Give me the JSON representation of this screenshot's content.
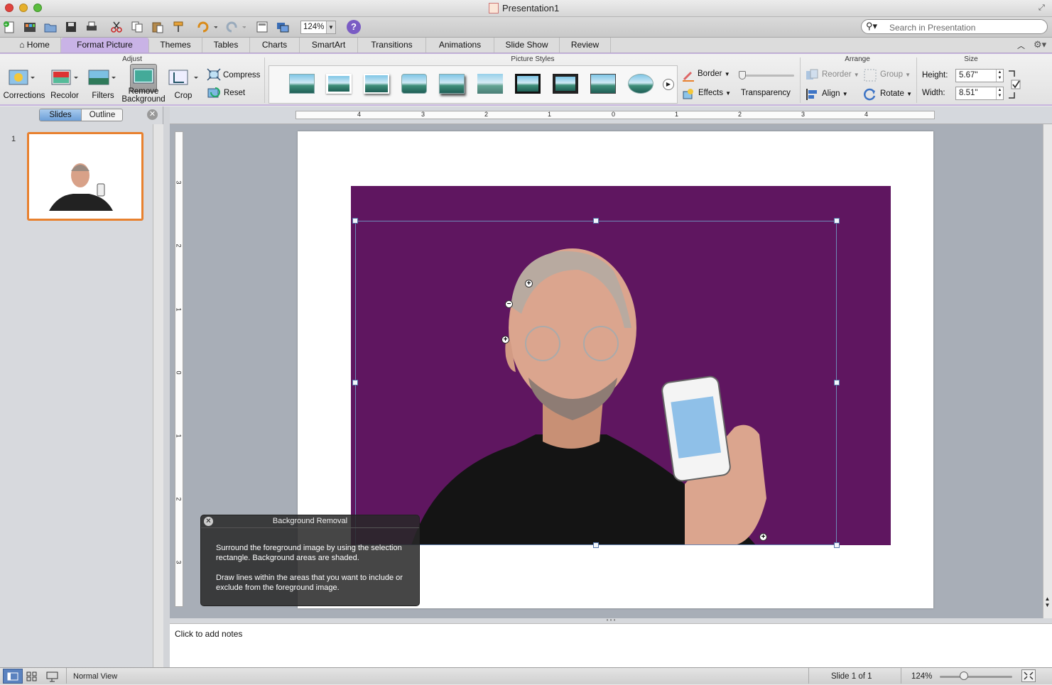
{
  "window": {
    "title": "Presentation1"
  },
  "toolbar": {
    "zoom_value": "124%",
    "search_placeholder": "Search in Presentation"
  },
  "tabs": [
    {
      "label": "Home"
    },
    {
      "label": "Format Picture"
    },
    {
      "label": "Themes"
    },
    {
      "label": "Tables"
    },
    {
      "label": "Charts"
    },
    {
      "label": "SmartArt"
    },
    {
      "label": "Transitions"
    },
    {
      "label": "Animations"
    },
    {
      "label": "Slide Show"
    },
    {
      "label": "Review"
    }
  ],
  "ribbon": {
    "groups": {
      "adjust": "Adjust",
      "picture_styles": "Picture Styles",
      "arrange": "Arrange",
      "size": "Size"
    },
    "adjust": {
      "corrections": "Corrections",
      "recolor": "Recolor",
      "filters": "Filters",
      "remove_background_1": "Remove",
      "remove_background_2": "Background",
      "crop": "Crop",
      "compress": "Compress",
      "reset": "Reset"
    },
    "styles": {
      "border": "Border",
      "effects": "Effects",
      "transparency": "Transparency"
    },
    "arrange": {
      "reorder": "Reorder",
      "group": "Group",
      "align": "Align",
      "rotate": "Rotate"
    },
    "size": {
      "height_label": "Height:",
      "height_value": "5.67\"",
      "width_label": "Width:",
      "width_value": "8.51\""
    }
  },
  "left_pane": {
    "slides_tab": "Slides",
    "outline_tab": "Outline",
    "slide_number": "1"
  },
  "ruler": {
    "h_ticks": [
      "4",
      "3",
      "2",
      "1",
      "0",
      "1",
      "2",
      "3",
      "4"
    ],
    "v_ticks": [
      "3",
      "2",
      "1",
      "0",
      "1",
      "2",
      "3"
    ]
  },
  "dialog": {
    "title": "Background Removal",
    "text1": "Surround the foreground image by using the selection rectangle. Background areas are shaded.",
    "text2": "Draw lines within the areas that you want to include or exclude from the foreground image."
  },
  "notes": {
    "placeholder": "Click to add notes"
  },
  "status": {
    "view": "Normal View",
    "slide": "Slide 1 of 1",
    "zoom": "124%"
  },
  "colors": {
    "accent_tab": "#c9b3e6",
    "shade": "#5f1660",
    "selection": "#e8812f"
  }
}
